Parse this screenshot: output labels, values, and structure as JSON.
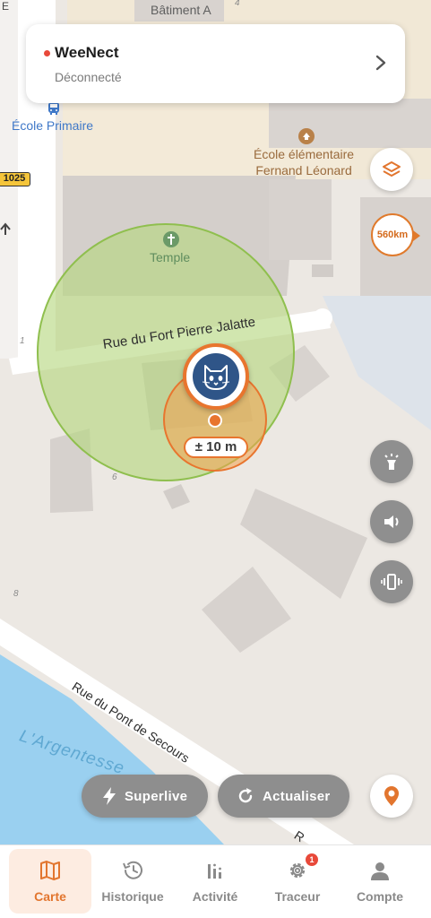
{
  "map": {
    "buildings": {
      "batiment": "Bâtiment A",
      "ecole_primaire": "École Primaire",
      "ecole_elementaire_l1": "École élémentaire",
      "ecole_elementaire_l2": "Fernand Léonard",
      "temple": "Temple"
    },
    "streets": {
      "fort": "Rue du Fort Pierre Jalatte",
      "pont": "Rue du Pont de Secours",
      "edge_letter": "R"
    },
    "river": "L'Argentesse",
    "route_number": "1025",
    "house_numbers": {
      "n4": "4",
      "n1": "1",
      "n6": "6",
      "n8": "8"
    }
  },
  "device": {
    "name": "WeeNect",
    "status": "Déconnecté",
    "status_color": "#e8493a"
  },
  "distance_badge": "560km",
  "pet": {
    "accuracy": "± 10 m"
  },
  "actions": {
    "superlive": "Superlive",
    "refresh": "Actualiser"
  },
  "tabs": [
    {
      "label": "Carte",
      "icon": "map-icon",
      "active": true
    },
    {
      "label": "Historique",
      "icon": "history-icon",
      "active": false
    },
    {
      "label": "Activité",
      "icon": "activity-icon",
      "active": false
    },
    {
      "label": "Traceur",
      "icon": "gear-icon",
      "active": false,
      "badge": "1"
    },
    {
      "label": "Compte",
      "icon": "user-icon",
      "active": false
    }
  ],
  "colors": {
    "accent": "#e2752e",
    "safe_zone": "#a4cc6a",
    "water": "#9ad0f0",
    "tracker_blue": "#2f5588"
  }
}
